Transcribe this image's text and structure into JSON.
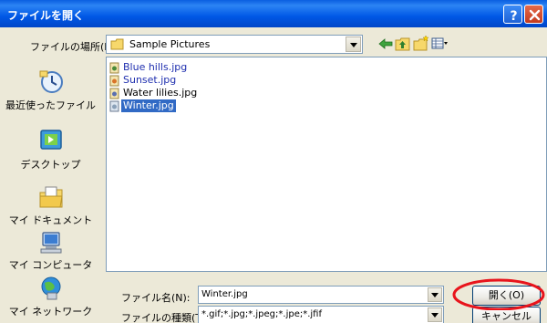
{
  "window": {
    "title": "ファイルを開く",
    "help_label": "?",
    "close_label": "X"
  },
  "toolbar": {
    "look_in_label": "ファイルの場所(I):",
    "look_in_value": "Sample Pictures",
    "icons": [
      "back-icon",
      "up-folder-icon",
      "new-folder-icon",
      "views-menu-icon"
    ]
  },
  "places": [
    {
      "label": "最近使ったファイル",
      "icon": "recent-icon"
    },
    {
      "label": "デスクトップ",
      "icon": "desktop-icon"
    },
    {
      "label": "マイ ドキュメント",
      "icon": "my-documents-icon"
    },
    {
      "label": "マイ コンピュータ",
      "icon": "my-computer-icon"
    },
    {
      "label": "マイ ネットワーク",
      "icon": "my-network-icon"
    }
  ],
  "files": [
    {
      "name": "Blue hills.jpg",
      "state": "normal"
    },
    {
      "name": "Sunset.jpg",
      "state": "normal"
    },
    {
      "name": "Water lilies.jpg",
      "state": "plain"
    },
    {
      "name": "Winter.jpg",
      "state": "selected"
    }
  ],
  "fields": {
    "filename_label": "ファイル名(N):",
    "filename_value": "Winter.jpg",
    "filetype_label": "ファイルの種類(T):",
    "filetype_value": "*.gif;*.jpg;*.jpeg;*.jpe;*.jfif"
  },
  "buttons": {
    "open_label": "開く(O)",
    "cancel_label": "キャンセル"
  },
  "colors": {
    "titlebar": "#0058E6",
    "selection": "#316AC5",
    "highlight_ellipse": "#E8141C"
  }
}
